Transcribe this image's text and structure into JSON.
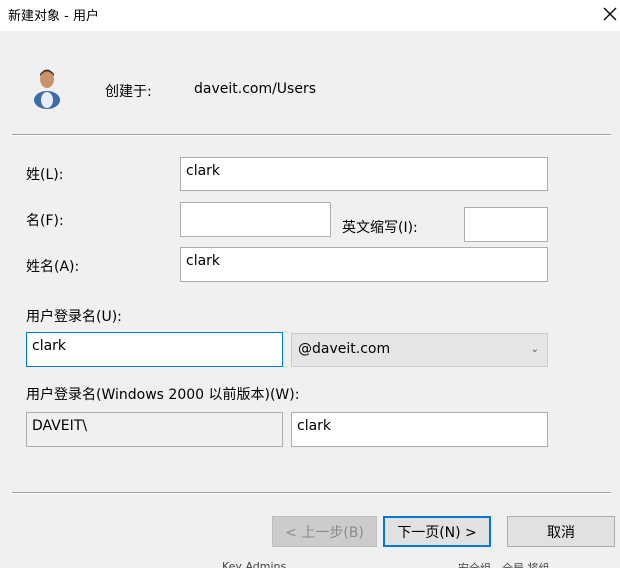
{
  "window": {
    "title": "新建对象 - 用户"
  },
  "header": {
    "created_in_label": "创建于:",
    "created_in_value": "daveit.com/Users"
  },
  "form": {
    "last_name_label": "姓(L):",
    "last_name_value": "clark",
    "first_name_label": "名(F):",
    "first_name_value": "",
    "initials_label": "英文缩写(I):",
    "initials_value": "",
    "full_name_label": "姓名(A):",
    "full_name_value": "clark",
    "logon_name_label": "用户登录名(U):",
    "logon_name_value": "clark",
    "upn_suffix_selected": "@daveit.com",
    "legacy_logon_label": "用户登录名(Windows 2000 以前版本)(W):",
    "legacy_domain_value": "DAVEIT\\",
    "legacy_logon_value": "clark"
  },
  "buttons": {
    "back": "< 上一步(B)",
    "next": "下一页(N) >",
    "cancel": "取消"
  },
  "background_text": {
    "left": "Key Admins",
    "right": "安全组 - 全局      将组"
  },
  "icons": {
    "close": "close-icon",
    "user": "user-avatar-icon",
    "dropdown": "chevron-down-icon"
  },
  "colors": {
    "accent": "#0078d7",
    "window_bg": "#f0f0f0",
    "titlebar_bg": "#ffffff"
  }
}
